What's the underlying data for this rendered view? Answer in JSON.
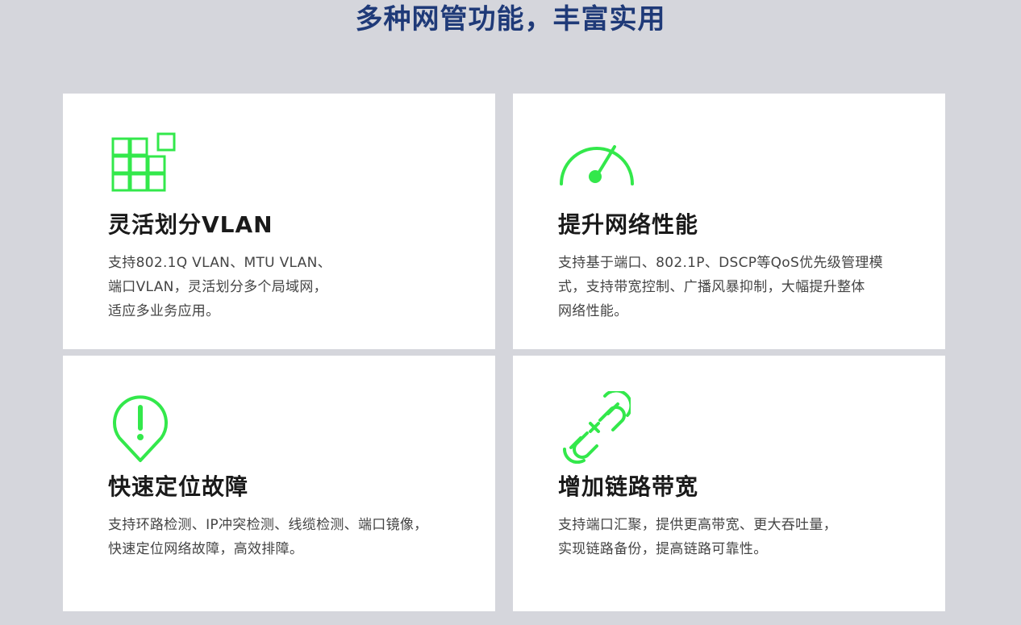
{
  "page": {
    "title": "多种网管功能，丰富实用"
  },
  "colors": {
    "accent": "#33e84b",
    "title": "#1f3a78",
    "background": "#d5d6dc",
    "card": "#ffffff",
    "text": "#444444"
  },
  "features": [
    {
      "icon": "grid-icon",
      "title": "灵活划分VLAN",
      "lines": [
        "支持802.1Q VLAN、MTU VLAN、",
        "端口VLAN，灵活划分多个局域网，",
        "适应多业务应用。"
      ]
    },
    {
      "icon": "gauge-icon",
      "title": "提升网络性能",
      "lines": [
        "支持基于端口、802.1P、DSCP等QoS优先级管理模",
        "式，支持带宽控制、广播风暴抑制，大幅提升整体",
        "网络性能。"
      ]
    },
    {
      "icon": "alert-pin-icon",
      "title": "快速定位故障",
      "lines": [
        "支持环路检测、IP冲突检测、线缆检测、端口镜像，",
        "快速定位网络故障，高效排障。"
      ]
    },
    {
      "icon": "broken-link-icon",
      "title": "增加链路带宽",
      "lines": [
        "支持端口汇聚，提供更高带宽、更大吞吐量，",
        "实现链路备份，提高链路可靠性。"
      ]
    }
  ]
}
